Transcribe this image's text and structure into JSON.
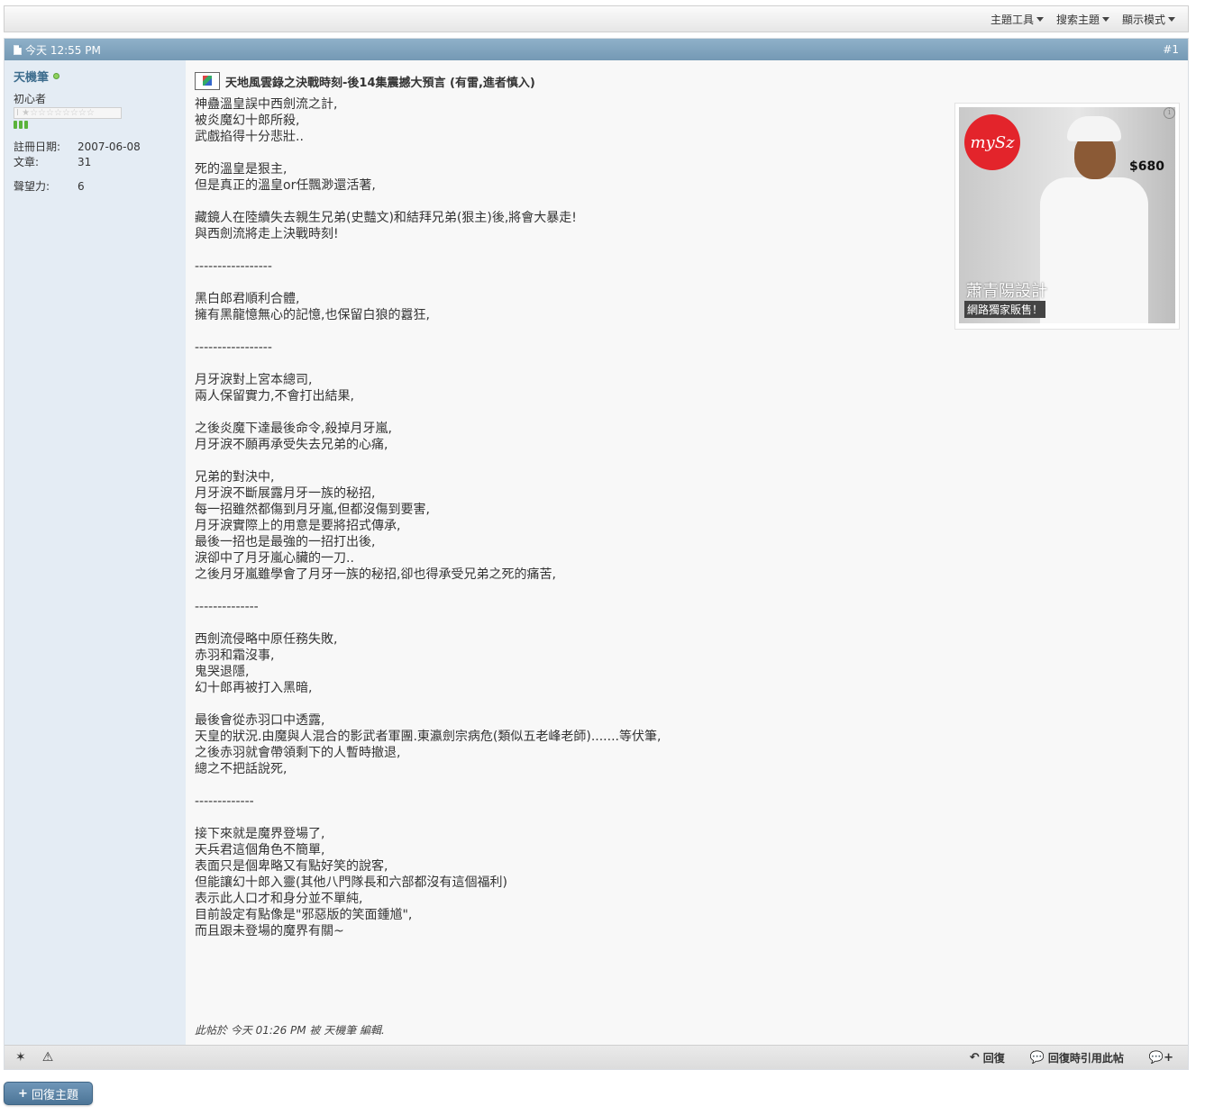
{
  "toolbar": {
    "items": [
      "主題工具",
      "搜索主題",
      "顯示模式"
    ]
  },
  "post": {
    "date": "今天 12:55 PM",
    "number": "#1",
    "author": {
      "name": "天機筆",
      "title": "初心者",
      "rank_stars": "I ★☆☆☆☆☆☆☆☆",
      "register_label": "註冊日期:",
      "register_value": "2007-06-08",
      "posts_label": "文章:",
      "posts_value": "31",
      "rep_label": "聲望力:",
      "rep_value": "6"
    },
    "title": "天地風雲錄之決戰時刻-後14集震撼大預言 (有雷,進者慎入)",
    "body": "神蠱溫皇誤中西劍流之計,\n被炎魔幻十郎所殺,\n武戲掐得十分悲壯..\n\n死的溫皇是狠主,\n但是真正的溫皇or任飄渺還活著,\n\n藏鏡人在陸續失去親生兄弟(史豔文)和結拜兄弟(狠主)後,將會大暴走!\n與西劍流將走上決戰時刻!\n\n-----------------\n\n黑白郎君順利合體,\n擁有黑龍憶無心的記憶,也保留白狼的囂狂,\n\n-----------------\n\n月牙淚對上宮本總司,\n兩人保留實力,不會打出結果,\n\n之後炎魔下達最後命令,殺掉月牙嵐,\n月牙淚不願再承受失去兄弟的心痛,\n\n兄弟的對決中,\n月牙淚不斷展露月牙一族的秘招,\n每一招雖然都傷到月牙嵐,但都沒傷到要害,\n月牙淚實際上的用意是要將招式傳承,\n最後一招也是最強的一招打出後,\n淚卻中了月牙嵐心臟的一刀..\n之後月牙嵐雖學會了月牙一族的秘招,卻也得承受兄弟之死的痛苦,\n\n--------------\n\n西劍流侵略中原任務失敗,\n赤羽和霜沒事,\n鬼哭退隱,\n幻十郎再被打入黑暗,\n\n最後會從赤羽口中透露,\n天皇的狀況.由魔與人混合的影武者軍團.東瀛劍宗病危(類似五老峰老師).......等伏筆,\n之後赤羽就會帶領剩下的人暫時撤退,\n總之不把話說死,\n\n-------------\n\n接下來就是魔界登場了,\n天兵君這個角色不簡單,\n表面只是個卑略又有點好笑的說客,\n但能讓幻十郎入靈(其他八門隊長和六部都沒有這個福利)\n表示此人口才和身分並不單純,\n目前設定有點像是\"邪惡版的笑面鍾馗\",\n而且跟未登場的魔界有關~",
    "edited": "此帖於 今天 01:26 PM 被 天機筆 編輯.",
    "ad": {
      "price": "$680",
      "caption_main": "蕭青陽設計",
      "caption_sub": "網路獨家販售！",
      "logo_text": "mySz",
      "info_icon": "info-icon"
    },
    "footer": {
      "reply": "回復",
      "quote": "回復時引用此帖",
      "multiquote_icon": "multiquote-icon"
    }
  },
  "reply_button": "回復主題",
  "colors": {
    "header_bar": "#7ea3bd",
    "userinfo_bg": "#e4ecf4",
    "username": "#3e6d8e",
    "reply_button": "#5a82a5"
  }
}
